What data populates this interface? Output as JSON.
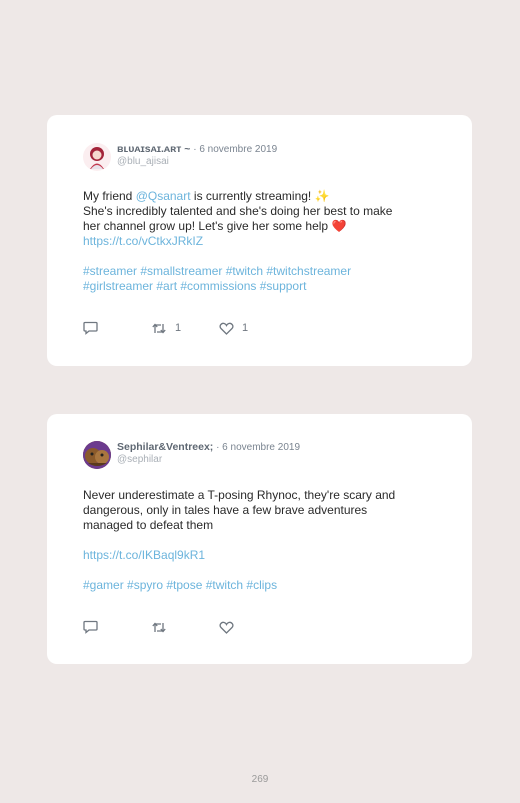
{
  "tweets": [
    {
      "display_name": "ʙʟᴜᴀɪsᴀɪ.ᴀʀᴛ ~",
      "date": "· 6 novembre 2019",
      "handle": "@blu_ajisai",
      "text": {
        "line1_prefix": "My friend ",
        "line1_mention": "@Qsanart",
        "line1_suffix": " is currently streaming! ✨",
        "line2": "She's incredibly talented and she's doing her best to make",
        "line3": "her channel grow up! Let's give her some help ❤️",
        "link": "https://t.co/vCtkxJRkIZ",
        "hashtags_line1": "#streamer #smallstreamer #twitch #twitchstreamer",
        "hashtags_line2": "#girlstreamer #art #commissions #support"
      },
      "actions": {
        "reply_count": "",
        "retweet_count": "1",
        "like_count": "1"
      }
    },
    {
      "display_name": "Sephilar&Ventreex;",
      "date": "· 6 novembre 2019",
      "handle": "@sephilar",
      "text": {
        "line1": "Never underestimate a T-posing Rhynoc, they're scary and",
        "line2": "dangerous, only in tales have a few brave adventures",
        "line3": "managed to defeat them",
        "link": "https://t.co/IKBaql9kR1",
        "hashtags": "#gamer #spyro #tpose #twitch #clips"
      },
      "actions": {
        "reply_count": "",
        "retweet_count": "",
        "like_count": ""
      }
    }
  ],
  "page_number": "269",
  "colors": {
    "background": "#eee8e7",
    "card": "#ffffff",
    "link": "#6cb4dc",
    "icon": "#6f7780"
  },
  "icons": [
    "reply-icon",
    "retweet-icon",
    "like-icon"
  ]
}
